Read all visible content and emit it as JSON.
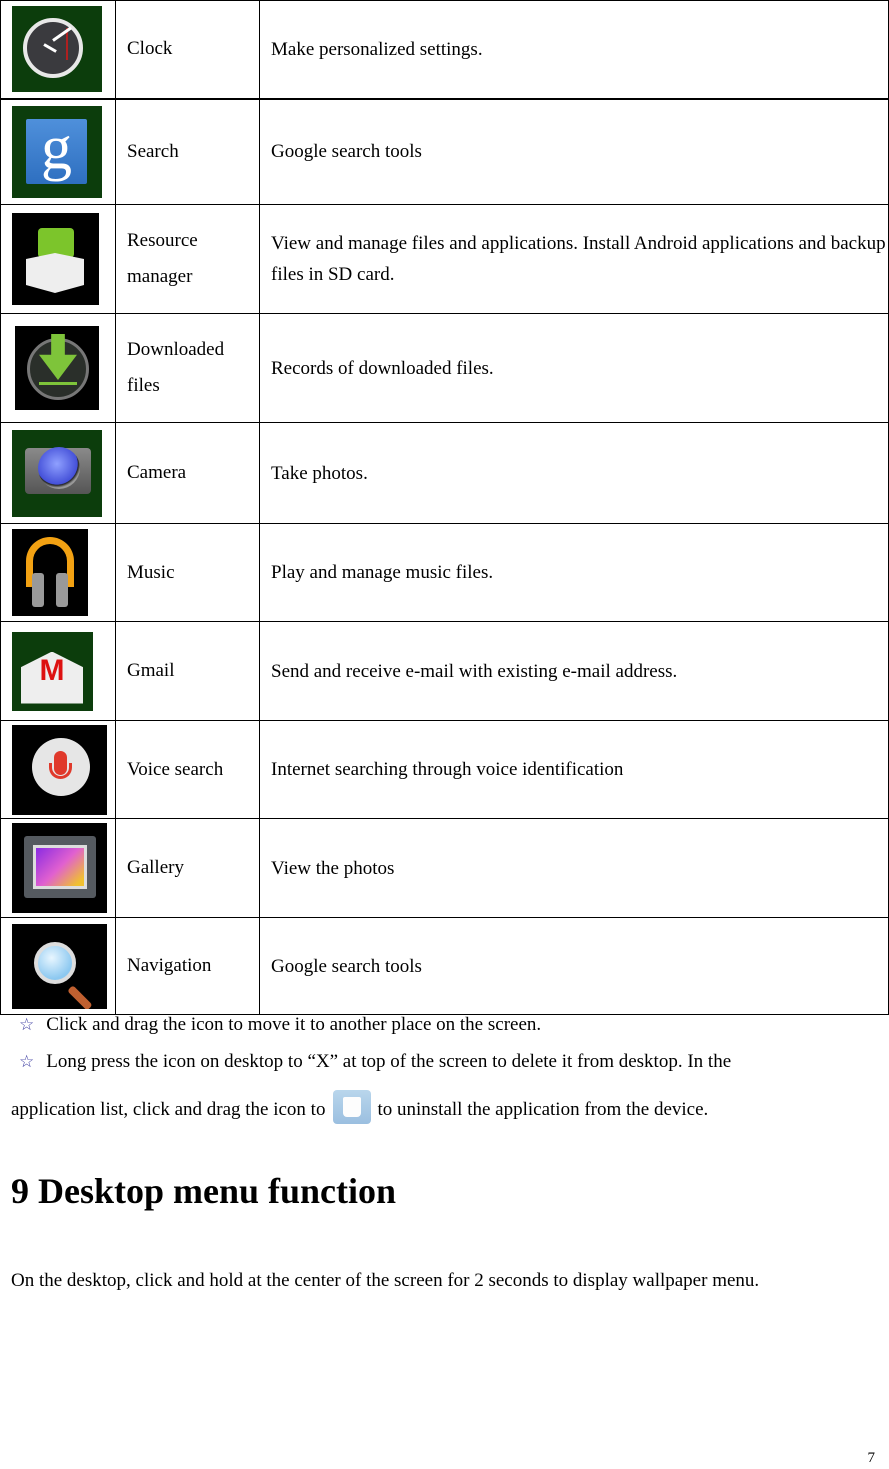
{
  "apps_table": {
    "rows": [
      {
        "icon": "clock-icon",
        "name": "Clock",
        "description": "Make personalized settings."
      },
      {
        "icon": "google-search-icon",
        "name": "Search",
        "description": "Google search tools"
      },
      {
        "icon": "resource-manager-icon",
        "name": "Resource manager",
        "description": "View and manage files and applications. Install Android applications and backup files in SD card."
      },
      {
        "icon": "download-icon",
        "name": "Downloaded files",
        "description": "Records of downloaded files."
      },
      {
        "icon": "camera-icon",
        "name": "Camera",
        "description": "Take photos."
      },
      {
        "icon": "headphones-icon",
        "name": "Music",
        "description": "Play and manage music files."
      },
      {
        "icon": "gmail-icon",
        "name": "Gmail",
        "description": "Send and receive e-mail with existing e-mail address."
      },
      {
        "icon": "microphone-icon",
        "name": "Voice search",
        "description": "Internet searching through voice identification"
      },
      {
        "icon": "gallery-icon",
        "name": "Gallery",
        "description": "View the photos"
      },
      {
        "icon": "magnifier-icon",
        "name": "Navigation",
        "description": "Google search tools"
      }
    ]
  },
  "notes": {
    "bullet_symbol": "☆",
    "note1": "Click and drag the icon to move it to another place on the screen.",
    "note2_line1": "Long press the icon on desktop to “X” at top of the screen to delete it from desktop. In the",
    "note2_line2_before": "application list, click and drag the icon to",
    "note2_icon": "trash-icon",
    "note2_line2_after": "to uninstall the application from the device."
  },
  "section": {
    "heading": "9 Desktop menu function",
    "paragraph": "On the desktop, click and hold at the center of the screen for 2 seconds to display wallpaper menu."
  },
  "page_number": "7"
}
